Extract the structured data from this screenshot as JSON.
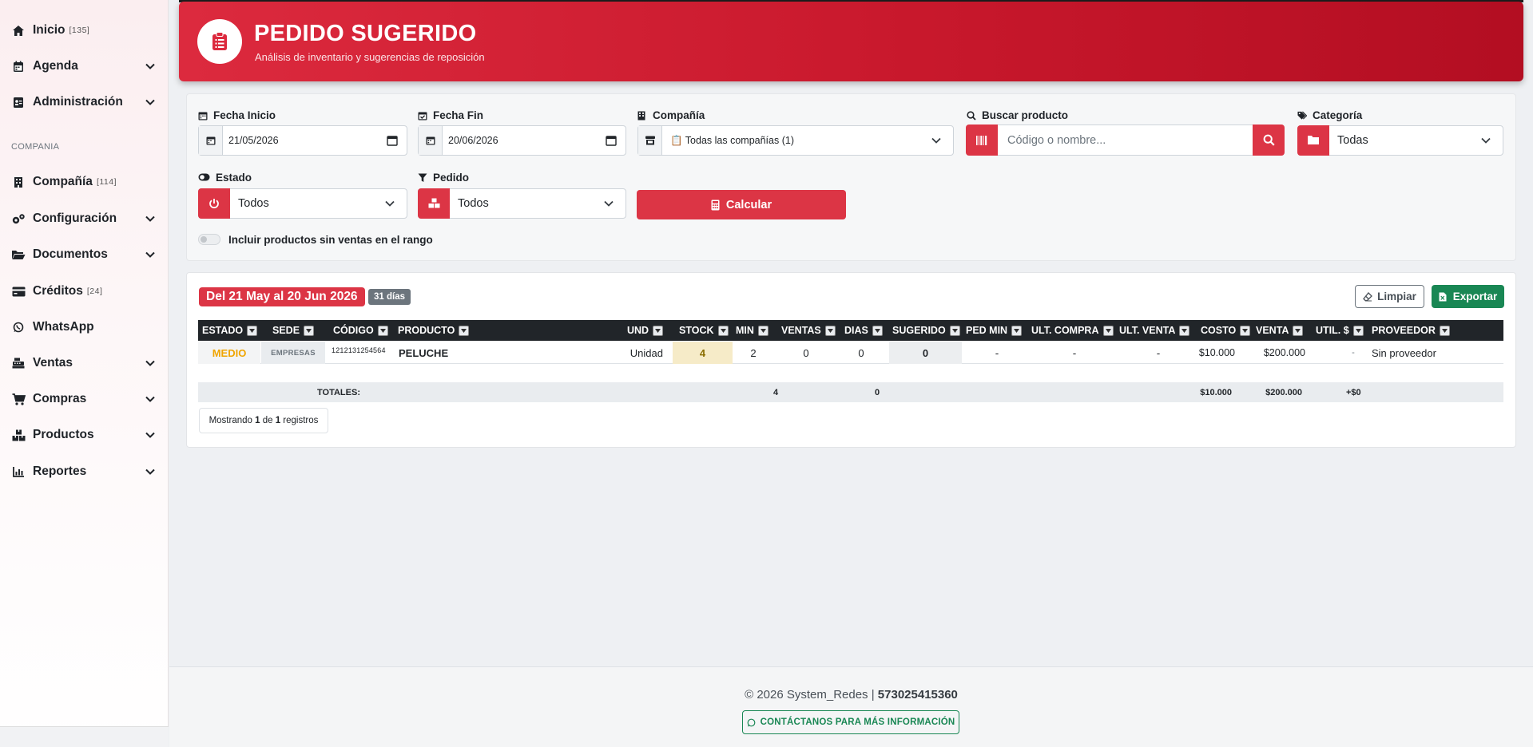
{
  "sidebar": {
    "items": [
      {
        "label": "Inicio",
        "count": "[135]",
        "icon": "home-icon"
      },
      {
        "label": "Agenda",
        "icon": "calendar-icon"
      },
      {
        "label": "Administración",
        "icon": "id-card-icon"
      },
      {
        "label": "Compañía",
        "count": "[114]",
        "icon": "building-icon"
      },
      {
        "label": "Configuración",
        "icon": "gears-icon"
      },
      {
        "label": "Documentos",
        "icon": "folder-icon"
      },
      {
        "label": "Créditos",
        "count": "[24]",
        "icon": "credit-card-icon"
      },
      {
        "label": "WhatsApp",
        "icon": "whatsapp-icon"
      },
      {
        "label": "Ventas",
        "icon": "cash-register-icon"
      },
      {
        "label": "Compras",
        "icon": "cart-icon"
      },
      {
        "label": "Productos",
        "icon": "boxes-icon"
      },
      {
        "label": "Reportes",
        "icon": "chart-icon"
      }
    ],
    "section_label": "COMPANIA"
  },
  "header": {
    "title": "PEDIDO SUGERIDO",
    "subtitle": "Análisis de inventario y sugerencias de reposición"
  },
  "filters": {
    "fecha_inicio": {
      "label": "Fecha Inicio",
      "value": "21/05/2026"
    },
    "fecha_fin": {
      "label": "Fecha Fin",
      "value": "20/06/2026"
    },
    "compania": {
      "label": "Compañía",
      "value": "📋 Todas las compañías (1)"
    },
    "buscar": {
      "label": "Buscar producto",
      "placeholder": "Código o nombre..."
    },
    "categoria": {
      "label": "Categoría",
      "value": "Todas"
    },
    "estado": {
      "label": "Estado",
      "value": "Todos"
    },
    "pedido": {
      "label": "Pedido",
      "value": "Todos"
    },
    "calcular_label": "Calcular",
    "toggle_label": "Incluir productos sin ventas en el rango"
  },
  "results": {
    "range": "Del 21 May al 20 Jun 2026",
    "days": "31 días",
    "limpiar_label": "Limpiar",
    "exportar_label": "Exportar",
    "columns": [
      "ESTADO",
      "SEDE",
      "CÓDIGO",
      "PRODUCTO",
      "UND",
      "STOCK",
      "MIN",
      "VENTAS",
      "DIAS",
      "SUGERIDO",
      "PED MIN",
      "ULT. COMPRA",
      "ULT. VENTA",
      "COSTO",
      "VENTA",
      "UTIL. $",
      "PROVEEDOR"
    ],
    "row": {
      "estado": "MEDIO",
      "sede": "EMPRESAS",
      "codigo": "1212131254564",
      "producto": "PELUCHE",
      "und": "Unidad",
      "stock": "4",
      "min": "2",
      "ventas": "0",
      "dias": "0",
      "sugerido": "0",
      "ped_min": "-",
      "ult_compra": "-",
      "ult_venta": "-",
      "costo": "$10.000",
      "venta": "$200.000",
      "util": "-",
      "proveedor": "Sin proveedor"
    },
    "totals": {
      "label": "TOTALES:",
      "stock": "4",
      "dias": "0",
      "costo": "$10.000",
      "venta": "$200.000",
      "util": "+$0"
    },
    "showing_pre": "Mostrando ",
    "showing_from": "1",
    "showing_mid": " de ",
    "showing_to": "1",
    "showing_post": " registros"
  },
  "footer": {
    "copyright": "© 2026 System_Redes | ",
    "phone": "573025415360",
    "contact_label": "CONTÁCTANOS PARA MÁS INFORMACIÓN"
  },
  "colors": {
    "primary": "#dc3545",
    "success": "#198754",
    "dark": "#212529",
    "warning_text": "#f0a500"
  }
}
